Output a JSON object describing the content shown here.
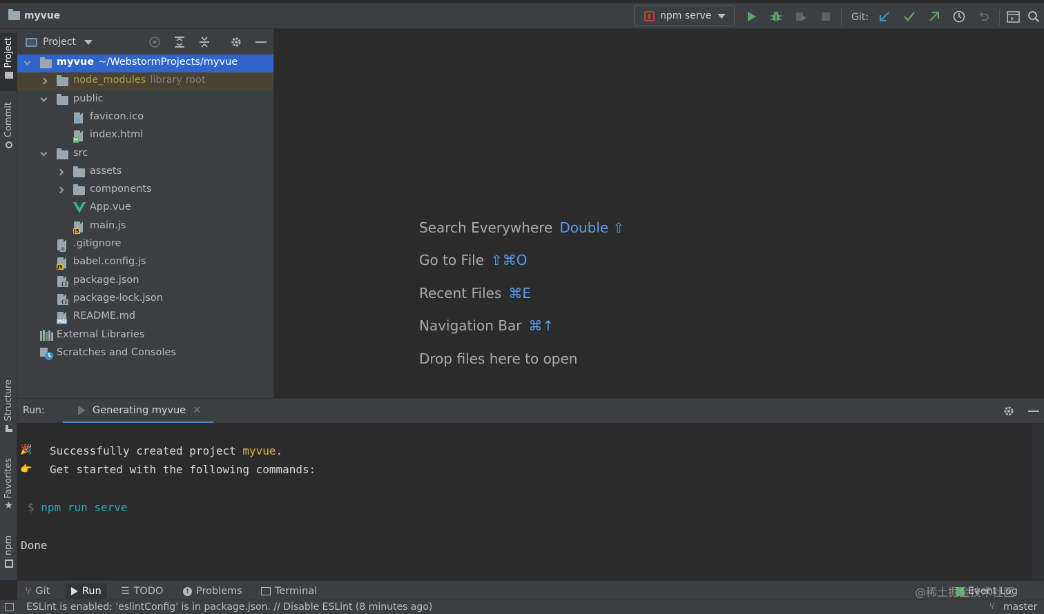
{
  "titlebar": {
    "project_name": "myvue",
    "run_config": "npm serve",
    "git_label": "Git:"
  },
  "left_strip": {
    "project": "Project",
    "commit": "Commit",
    "structure": "Structure",
    "favorites": "Favorites",
    "npm": "npm"
  },
  "project_panel": {
    "title": "Project",
    "tree": [
      {
        "label": "myvue",
        "suffix": "~/WebstormProjects/myvue",
        "depth": 0,
        "expander": "open",
        "icon": "folder-icon",
        "selected": true
      },
      {
        "label": "node_modules",
        "suffix": "library root",
        "depth": 1,
        "expander": "closed",
        "icon": "folder-icon",
        "library": true
      },
      {
        "label": "public",
        "depth": 1,
        "expander": "open",
        "icon": "folder-icon"
      },
      {
        "label": "favicon.ico",
        "depth": 2,
        "expander": "none",
        "icon": "image-file-icon"
      },
      {
        "label": "index.html",
        "depth": 2,
        "expander": "none",
        "icon": "html-file-icon"
      },
      {
        "label": "src",
        "depth": 1,
        "expander": "open",
        "icon": "folder-icon"
      },
      {
        "label": "assets",
        "depth": 2,
        "expander": "closed",
        "icon": "folder-icon"
      },
      {
        "label": "components",
        "depth": 2,
        "expander": "closed",
        "icon": "folder-icon"
      },
      {
        "label": "App.vue",
        "depth": 2,
        "expander": "none",
        "icon": "vue-icon"
      },
      {
        "label": "main.js",
        "depth": 2,
        "expander": "none",
        "icon": "js-file-icon"
      },
      {
        "label": ".gitignore",
        "depth": 1,
        "expander": "none",
        "icon": "gitignore-file-icon"
      },
      {
        "label": "babel.config.js",
        "depth": 1,
        "expander": "none",
        "icon": "js-file-icon"
      },
      {
        "label": "package.json",
        "depth": 1,
        "expander": "none",
        "icon": "json-file-icon"
      },
      {
        "label": "package-lock.json",
        "depth": 1,
        "expander": "none",
        "icon": "json-file-icon"
      },
      {
        "label": "README.md",
        "depth": 1,
        "expander": "none",
        "icon": "markdown-file-icon"
      },
      {
        "label": "External Libraries",
        "depth": 0,
        "expander": "none",
        "icon": "libraries-icon"
      },
      {
        "label": "Scratches and Consoles",
        "depth": 0,
        "expander": "none",
        "icon": "scratches-icon"
      }
    ]
  },
  "editor_hints": [
    {
      "text": "Search Everywhere",
      "key": "Double ⇧"
    },
    {
      "text": "Go to File",
      "key": "⇧⌘O"
    },
    {
      "text": "Recent Files",
      "key": "⌘E"
    },
    {
      "text": "Navigation Bar",
      "key": "⌘↑"
    },
    {
      "text": "Drop files here to open",
      "key": ""
    }
  ],
  "run_window": {
    "label": "Run:",
    "tab": "Generating myvue",
    "console": {
      "line1_prefix": "Successfully created project ",
      "line1_project": "myvue",
      "line1_suffix": ".",
      "line2": "Get started with the following commands:",
      "prompt": "$",
      "command": "npm run serve",
      "done": "Done",
      "emoji1": "🎉",
      "emoji2": "👉"
    }
  },
  "bottom_tabs": {
    "git": "Git",
    "run": "Run",
    "todo": "TODO",
    "problems": "Problems",
    "terminal": "Terminal",
    "event_log": "Event Log"
  },
  "status": {
    "message": "ESLint is enabled: 'eslintConfig' is in package.json. // Disable ESLint (8 minutes ago)",
    "branch": "master",
    "watermark": "@稀土掘金技术社区"
  },
  "colors": {
    "accent": "#2f65ca",
    "key_blue": "#589df6",
    "project_yellow": "#d7b84a",
    "cmd_teal": "#2aa8b8",
    "lib_yellow": "#a8a146"
  }
}
